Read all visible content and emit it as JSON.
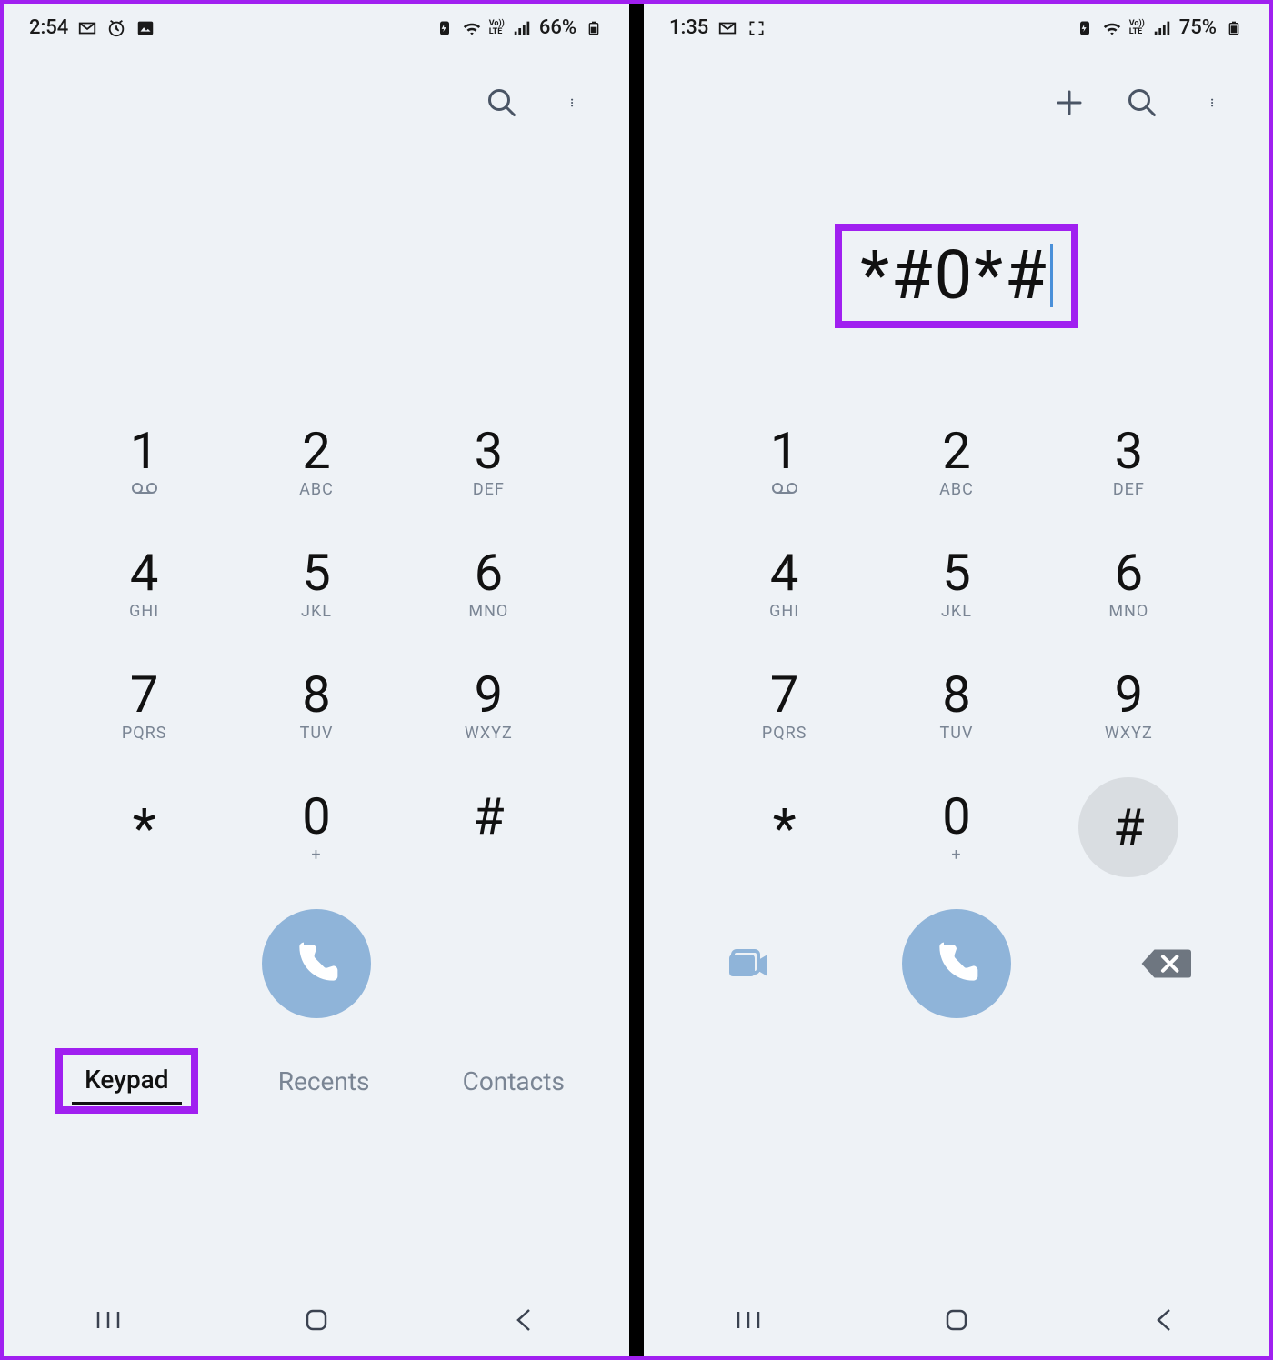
{
  "left": {
    "status": {
      "time": "2:54",
      "battery": "66%"
    },
    "dial_display": "",
    "tabs": {
      "keypad": "Keypad",
      "recents": "Recents",
      "contacts": "Contacts"
    }
  },
  "right": {
    "status": {
      "time": "1:35",
      "battery": "75%"
    },
    "dial_display": "*#0*#"
  },
  "keypad": [
    {
      "digit": "1",
      "sub": "voicemail"
    },
    {
      "digit": "2",
      "sub": "ABC"
    },
    {
      "digit": "3",
      "sub": "DEF"
    },
    {
      "digit": "4",
      "sub": "GHI"
    },
    {
      "digit": "5",
      "sub": "JKL"
    },
    {
      "digit": "6",
      "sub": "MNO"
    },
    {
      "digit": "7",
      "sub": "PQRS"
    },
    {
      "digit": "8",
      "sub": "TUV"
    },
    {
      "digit": "9",
      "sub": "WXYZ"
    },
    {
      "digit": "*",
      "sub": ""
    },
    {
      "digit": "0",
      "sub": "+"
    },
    {
      "digit": "#",
      "sub": ""
    }
  ],
  "icons": {
    "volte": "Vo))\nLTE"
  }
}
